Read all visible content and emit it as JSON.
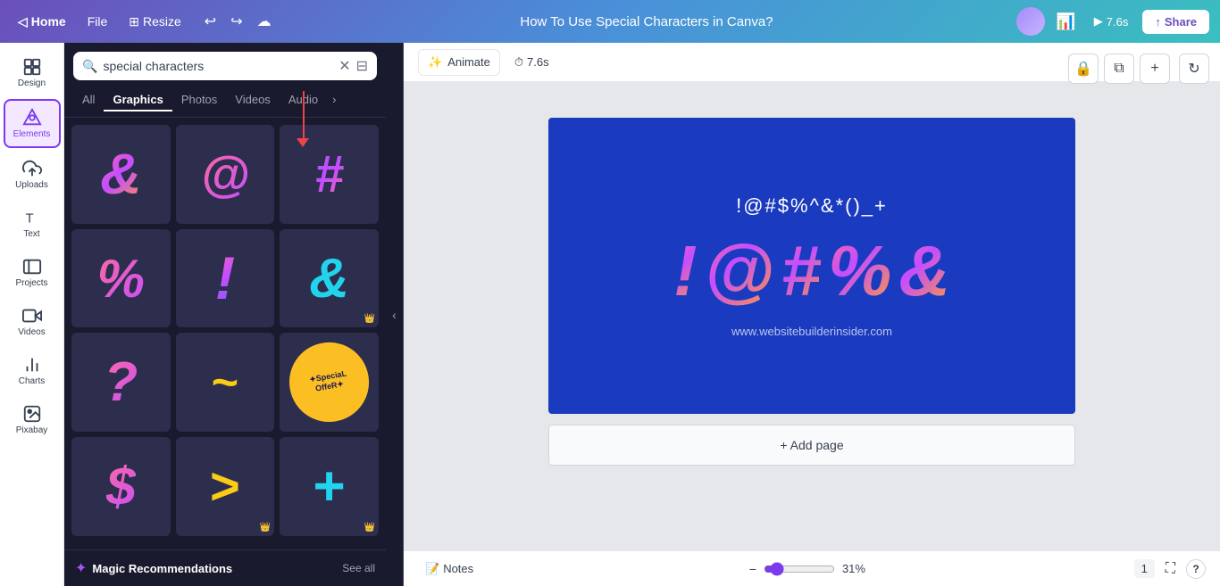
{
  "app": {
    "title": "How To Use Special Characters in Canva?",
    "nav": {
      "home": "Home",
      "file": "File",
      "resize": "Resize",
      "undo": "↩",
      "redo": "↪",
      "save_icon": "☁",
      "time": "7.6s",
      "share": "Share",
      "play_label": "7.6s"
    }
  },
  "sidebar": {
    "items": [
      {
        "id": "design",
        "label": "Design",
        "icon": "design"
      },
      {
        "id": "elements",
        "label": "Elements",
        "icon": "elements",
        "active": true
      },
      {
        "id": "uploads",
        "label": "Uploads",
        "icon": "uploads"
      },
      {
        "id": "text",
        "label": "Text",
        "icon": "text"
      },
      {
        "id": "projects",
        "label": "Projects",
        "icon": "projects"
      },
      {
        "id": "videos",
        "label": "Videos",
        "icon": "videos"
      },
      {
        "id": "charts",
        "label": "Charts",
        "icon": "charts"
      },
      {
        "id": "pixabay",
        "label": "Pixabay",
        "icon": "pixabay"
      }
    ]
  },
  "search_panel": {
    "search_value": "special characters",
    "clear_label": "✕",
    "filter_icon": "⊞",
    "tabs": [
      {
        "id": "all",
        "label": "All"
      },
      {
        "id": "graphics",
        "label": "Graphics",
        "active": true
      },
      {
        "id": "photos",
        "label": "Photos"
      },
      {
        "id": "videos",
        "label": "Videos"
      },
      {
        "id": "audio",
        "label": "Audio"
      },
      {
        "id": "more",
        "label": "›"
      }
    ],
    "grid_items": [
      {
        "id": 1,
        "symbol": "&",
        "type": "ampersand",
        "premium": false
      },
      {
        "id": 2,
        "symbol": "@",
        "type": "at",
        "premium": false
      },
      {
        "id": 3,
        "symbol": "#",
        "type": "hash",
        "premium": false
      },
      {
        "id": 4,
        "symbol": "%",
        "type": "percent",
        "premium": false
      },
      {
        "id": 5,
        "symbol": "!",
        "type": "exclaim",
        "premium": false
      },
      {
        "id": 6,
        "symbol": "&",
        "type": "cyan-amp",
        "premium": true
      },
      {
        "id": 7,
        "symbol": "?",
        "type": "question",
        "premium": false
      },
      {
        "id": 8,
        "symbol": "~",
        "type": "tilde",
        "premium": false
      },
      {
        "id": 9,
        "symbol": "★SpeciaL OffeR ★",
        "type": "offer",
        "premium": false
      },
      {
        "id": 10,
        "symbol": "$",
        "type": "dollar",
        "premium": false
      },
      {
        "id": 11,
        "symbol": ">",
        "type": "greater",
        "premium": true
      },
      {
        "id": 12,
        "symbol": "+",
        "type": "plus",
        "premium": true
      }
    ],
    "magic": {
      "icon": "✦",
      "label": "Magic Recommendations",
      "see_all": "See all"
    }
  },
  "canvas": {
    "slide": {
      "text_top": "!@#$%^&*()_+",
      "symbols": [
        "!",
        "@",
        "#",
        "%",
        "&"
      ],
      "url": "www.websitebuilderinsider.com"
    },
    "add_page": "+ Add page",
    "toolbar": {
      "lock": "🔒",
      "copy": "⧉",
      "more": "+"
    }
  },
  "animate_toolbar": {
    "animate_label": "Animate",
    "animate_icon": "✨",
    "time_icon": "⏱",
    "time_label": "7.6s"
  },
  "bottom_bar": {
    "notes_label": "Notes",
    "notes_icon": "📝",
    "zoom": "31%",
    "page_number": "1",
    "fullscreen_icon": "⛶",
    "help_icon": "?"
  }
}
